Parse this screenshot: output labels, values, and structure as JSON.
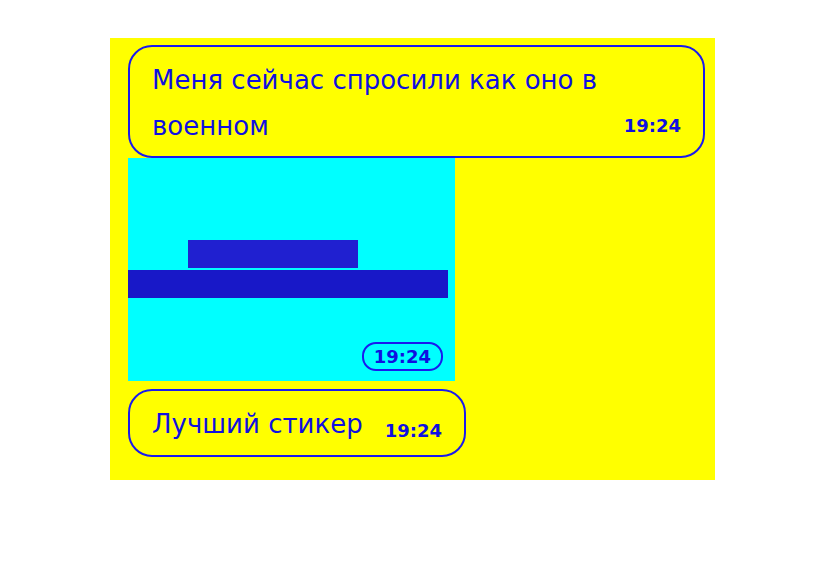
{
  "messages": [
    {
      "kind": "text",
      "text": "Меня сейчас спросили как оно в военном",
      "time": "19:24"
    },
    {
      "kind": "sticker",
      "time": "19:24"
    },
    {
      "kind": "text",
      "text": "Лучший стикер",
      "time": "19:24"
    }
  ]
}
